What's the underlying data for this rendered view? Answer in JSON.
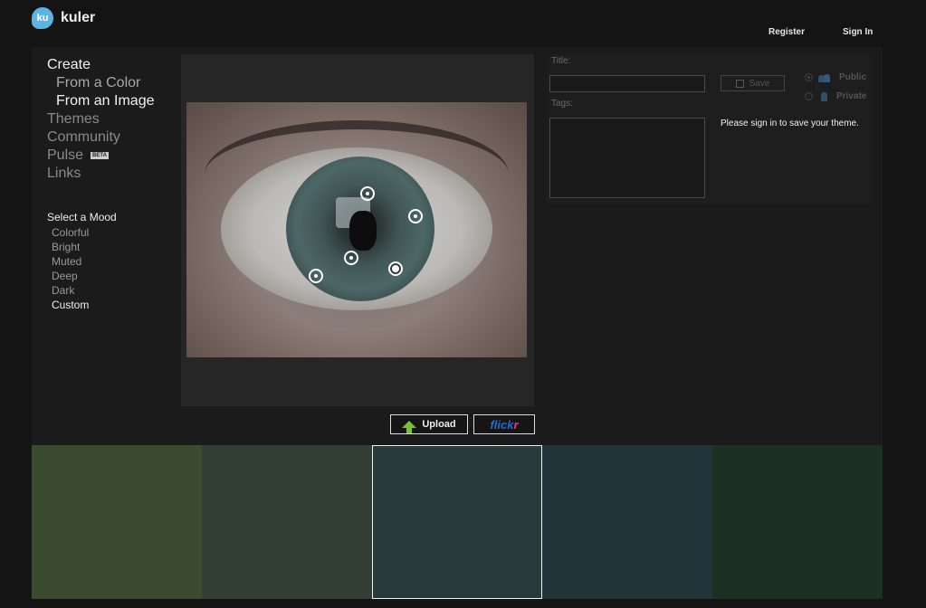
{
  "header": {
    "logo_badge": "ku",
    "logo_text": "kuler",
    "register": "Register",
    "sign_in": "Sign In"
  },
  "nav": {
    "create": "Create",
    "from_color": "From a Color",
    "from_image": "From an Image",
    "themes": "Themes",
    "community": "Community",
    "pulse": "Pulse",
    "beta": "BETA",
    "links": "Links"
  },
  "mood": {
    "title": "Select a Mood",
    "items": [
      "Colorful",
      "Bright",
      "Muted",
      "Deep",
      "Dark",
      "Custom"
    ],
    "selected": "Custom"
  },
  "buttons": {
    "upload": "Upload",
    "flickr_a": "flick",
    "flickr_b": "r"
  },
  "form": {
    "title_label": "Title:",
    "tags_label": "Tags:",
    "title_value": "",
    "tags_value": "",
    "save": "Save",
    "public": "Public",
    "private": "Private",
    "signin_message": "Please sign in to save your theme."
  },
  "swatches": [
    {
      "color": "#3a4b2f"
    },
    {
      "color": "#323e33"
    },
    {
      "color": "#283a39",
      "selected": true
    },
    {
      "color": "#213439"
    },
    {
      "color": "#1e3022"
    }
  ],
  "colors": {
    "background": "#141414",
    "panel": "#1b1b1b",
    "logo_blue": "#5fb3e4",
    "upload_green": "#7dbb3a",
    "flickr_blue": "#1a6fd6",
    "flickr_pink": "#ff2a8a"
  }
}
